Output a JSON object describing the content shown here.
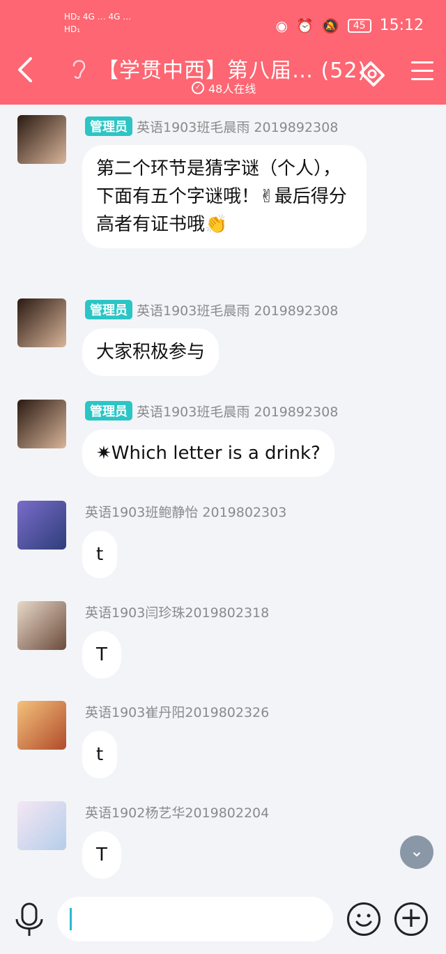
{
  "statusbar": {
    "left_line1": "HD₂ 4G … 4G …",
    "left_line2": "HD₁",
    "battery": "45",
    "time": "15:12"
  },
  "header": {
    "title": "【学贯中西】第八届…  (52)",
    "online": "48人在线"
  },
  "messages": [
    {
      "admin_label": "管理员",
      "sender": "英语1903班毛晨雨 2019892308",
      "text": "第二个环节是猜字谜（个人），下面有五个字谜哦！✌最后得分高者有证书哦👏"
    },
    {
      "admin_label": "管理员",
      "sender": "英语1903班毛晨雨 2019892308",
      "text": "大家积极参与"
    },
    {
      "admin_label": "管理员",
      "sender": "英语1903班毛晨雨 2019892308",
      "text": "✷Which letter is a drink?"
    },
    {
      "sender": "英语1903班鲍静怡 2019802303",
      "text": "t"
    },
    {
      "sender": "英语1903闫珍珠2019802318",
      "text": "T"
    },
    {
      "sender": "英语1903崔丹阳2019802326",
      "text": "t"
    },
    {
      "sender": "英语1902杨艺华2019802204",
      "text": "T"
    }
  ],
  "colors": {
    "header": "#fd6672",
    "admin_badge": "#2cc5c5",
    "cursor": "#27b7d4"
  }
}
